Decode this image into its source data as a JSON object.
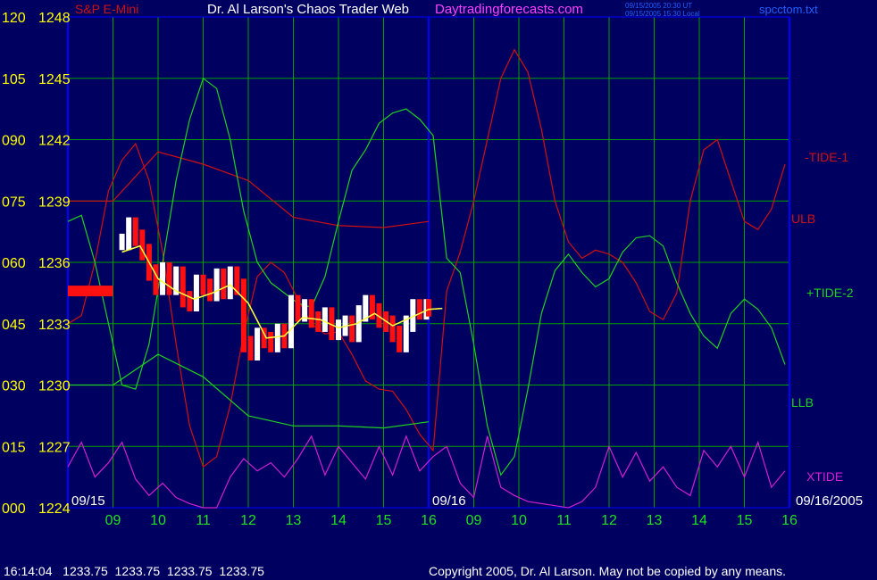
{
  "header": {
    "symbol": "S&P E-Mini",
    "title": "Dr. Al Larson's Chaos Trader Web",
    "site": "Daytradingforecasts.com",
    "time_utc": "09/15/2005 20:30 UT",
    "time_local": "09/15/2005 15:30 Local",
    "file": "spcctom.txt"
  },
  "footer": {
    "quote": "16:14:04   1233.75  1233.75  1233.75  1233.75",
    "copyright": "Copyright 2005, Dr. Al Larson. May not be copied by any means."
  },
  "colors": {
    "background": "#000060",
    "grid": "#00a000",
    "axis": "#0000ff",
    "tide1": "#d01010",
    "tide2": "#20d020",
    "xtide": "#d020d0",
    "price_up": "#ffffff",
    "price_down": "#ff1010",
    "avg": "#ffff40",
    "left_label": "#ffff00",
    "time_label": "#20e020",
    "title": "#ffffff",
    "site": "#ff40ff",
    "file": "#2060ff"
  },
  "chart_data": {
    "type": "line",
    "y_left_labels": [
      "000",
      "015",
      "030",
      "045",
      "060",
      "075",
      "090",
      "105",
      "120"
    ],
    "y_price_labels": [
      "1224",
      "1227",
      "1230",
      "1233",
      "1236",
      "1239",
      "1242",
      "1245",
      "1248"
    ],
    "ylim": [
      1224,
      1248
    ],
    "x_hours": [
      "09",
      "10",
      "11",
      "12",
      "13",
      "14",
      "15",
      "16",
      "09",
      "10",
      "11",
      "12",
      "13",
      "14",
      "15",
      "16"
    ],
    "date_left": "09/15",
    "date_mid": "09/16",
    "date_right": "09/16/2005",
    "right_labels": [
      "-TIDE-1",
      "ULB",
      "+TIDE-2",
      "LLB",
      "XTIDE"
    ],
    "series": [
      {
        "name": "-TIDE-1",
        "x": [
          0,
          0.3,
          0.6,
          0.9,
          1.2,
          1.5,
          1.8,
          2.1,
          2.4,
          2.7,
          3.0,
          3.3,
          3.6,
          3.9,
          4.2,
          4.5,
          4.8,
          5.1,
          5.4,
          5.7,
          6.0,
          6.3,
          6.6,
          6.9,
          7.2,
          7.5,
          7.8,
          8.1,
          8.4,
          8.7,
          9.0,
          9.3,
          9.6,
          9.9,
          10.2,
          10.5,
          10.8,
          11.1,
          11.4,
          11.7,
          12.0,
          12.3,
          12.6,
          12.9,
          13.2,
          13.5,
          13.8,
          14.1,
          14.4,
          14.7,
          15.0,
          15.3,
          15.6,
          15.9
        ],
        "y": [
          1233.0,
          1233.4,
          1236.0,
          1239.5,
          1241.0,
          1241.8,
          1240.0,
          1236.5,
          1232.0,
          1228.0,
          1226.0,
          1226.5,
          1229.0,
          1232.5,
          1235.3,
          1236.0,
          1235.5,
          1234.2,
          1233.0,
          1232.5,
          1232.6,
          1231.5,
          1230.2,
          1229.8,
          1229.7,
          1228.8,
          1227.6,
          1226.8,
          1234.6,
          1236.5,
          1239.0,
          1242.0,
          1245.0,
          1246.4,
          1245.3,
          1242.5,
          1239.0,
          1237.0,
          1236.2,
          1236.6,
          1236.4,
          1236.0,
          1235.0,
          1233.6,
          1233.2,
          1234.5,
          1239.0,
          1241.5,
          1242.0,
          1240.0,
          1238.0,
          1237.6,
          1238.6,
          1240.8
        ]
      },
      {
        "name": "ULB",
        "x": [
          0,
          1,
          2,
          3,
          4,
          5,
          6,
          7,
          8
        ],
        "y": [
          1239.0,
          1239.0,
          1241.4,
          1240.8,
          1240.0,
          1238.2,
          1237.8,
          1237.7,
          1238.0
        ]
      },
      {
        "name": "+TIDE-2",
        "x": [
          0,
          0.3,
          0.6,
          0.9,
          1.2,
          1.5,
          1.8,
          2.1,
          2.4,
          2.7,
          3.0,
          3.3,
          3.6,
          3.9,
          4.2,
          4.5,
          4.8,
          5.1,
          5.4,
          5.7,
          6.0,
          6.3,
          6.6,
          6.9,
          7.2,
          7.5,
          7.8,
          8.1,
          8.4,
          8.7,
          9.0,
          9.3,
          9.6,
          9.9,
          10.2,
          10.5,
          10.8,
          11.1,
          11.4,
          11.7,
          12.0,
          12.3,
          12.6,
          12.9,
          13.2,
          13.5,
          13.8,
          14.1,
          14.4,
          14.7,
          15.0,
          15.3,
          15.6,
          15.9
        ],
        "y": [
          1238.0,
          1238.3,
          1236.0,
          1233.0,
          1230.0,
          1229.8,
          1232.0,
          1236.0,
          1240.0,
          1243.0,
          1245.0,
          1244.5,
          1242.0,
          1238.5,
          1236.0,
          1235.0,
          1234.5,
          1234.0,
          1233.8,
          1235.3,
          1238.0,
          1240.5,
          1241.5,
          1242.8,
          1243.3,
          1243.5,
          1243.0,
          1242.2,
          1236.2,
          1235.5,
          1232.0,
          1228.0,
          1225.6,
          1226.5,
          1229.8,
          1233.5,
          1235.6,
          1236.4,
          1235.5,
          1234.8,
          1235.2,
          1236.5,
          1237.2,
          1237.3,
          1236.8,
          1235.0,
          1233.5,
          1232.4,
          1231.8,
          1233.5,
          1234.2,
          1233.7,
          1232.8,
          1231.0
        ]
      },
      {
        "name": "LLB",
        "x": [
          0,
          1,
          2,
          3,
          4,
          5,
          6,
          7,
          8
        ],
        "y": [
          1230.0,
          1230.0,
          1231.5,
          1230.4,
          1228.5,
          1228.0,
          1228.0,
          1227.9,
          1228.2
        ]
      },
      {
        "name": "XTIDE",
        "x": [
          0,
          0.3,
          0.6,
          0.9,
          1.2,
          1.5,
          1.8,
          2.1,
          2.4,
          2.7,
          3.0,
          3.3,
          3.6,
          3.9,
          4.2,
          4.5,
          4.8,
          5.1,
          5.4,
          5.7,
          6.0,
          6.3,
          6.6,
          6.9,
          7.2,
          7.5,
          7.8,
          8.1,
          8.4,
          8.7,
          9.0,
          9.3,
          9.6,
          9.9,
          10.2,
          10.5,
          10.8,
          11.1,
          11.4,
          11.7,
          12.0,
          12.3,
          12.6,
          12.9,
          13.2,
          13.5,
          13.8,
          14.1,
          14.4,
          14.7,
          15.0,
          15.3,
          15.6,
          15.9
        ],
        "y": [
          1226.0,
          1227.2,
          1225.5,
          1226.2,
          1227.2,
          1225.4,
          1224.6,
          1225.2,
          1224.5,
          1224.2,
          1224.0,
          1224.0,
          1225.5,
          1226.4,
          1225.8,
          1226.2,
          1225.5,
          1226.4,
          1227.5,
          1225.6,
          1227.0,
          1226.2,
          1225.4,
          1227.0,
          1225.6,
          1227.5,
          1225.8,
          1226.5,
          1227.0,
          1225.2,
          1224.5,
          1227.5,
          1225.0,
          1224.6,
          1224.3,
          1224.2,
          1224.1,
          1224.0,
          1224.3,
          1225.0,
          1227.0,
          1225.5,
          1226.7,
          1225.3,
          1226.0,
          1225.0,
          1224.6,
          1226.8,
          1226.0,
          1227.0,
          1225.5,
          1227.2,
          1225.0,
          1225.8
        ]
      },
      {
        "name": "price",
        "x": [
          1.2,
          1.35,
          1.5,
          1.65,
          1.8,
          1.95,
          2.1,
          2.25,
          2.4,
          2.55,
          2.7,
          2.85,
          3.0,
          3.15,
          3.3,
          3.45,
          3.6,
          3.75,
          3.9,
          4.05,
          4.2,
          4.35,
          4.5,
          4.65,
          4.8,
          4.95,
          5.1,
          5.25,
          5.4,
          5.55,
          5.7,
          5.85,
          6.0,
          6.15,
          6.3,
          6.45,
          6.6,
          6.75,
          6.9,
          7.05,
          7.2,
          7.35,
          7.5,
          7.65,
          7.8,
          7.95,
          8.0
        ],
        "y": [
          1237.0,
          1237.8,
          1237.2,
          1236.5,
          1235.5,
          1234.8,
          1235.6,
          1234.8,
          1235.4,
          1234.2,
          1234.0,
          1235.0,
          1234.8,
          1234.5,
          1235.3,
          1234.6,
          1235.4,
          1234.8,
          1232.0,
          1231.6,
          1232.4,
          1232.2,
          1232.0,
          1232.6,
          1232.2,
          1234.0,
          1233.5,
          1233.8,
          1233.2,
          1233.0,
          1233.4,
          1232.6,
          1232.8,
          1233.0,
          1232.5,
          1233.5,
          1234.0,
          1233.6,
          1233.2,
          1233.0,
          1232.5,
          1232.0,
          1233.0,
          1233.8,
          1233.6,
          1233.8,
          1233.75
        ]
      },
      {
        "name": "avg",
        "x": [
          1.2,
          1.6,
          2.0,
          2.4,
          2.8,
          3.2,
          3.6,
          4.0,
          4.4,
          4.8,
          5.2,
          5.6,
          6.0,
          6.4,
          6.8,
          7.2,
          7.6,
          8.0,
          8.3
        ],
        "y": [
          1236.5,
          1236.8,
          1235.2,
          1234.6,
          1234.2,
          1234.5,
          1234.9,
          1234.0,
          1232.3,
          1232.4,
          1233.3,
          1233.2,
          1232.8,
          1233.0,
          1233.5,
          1232.9,
          1233.3,
          1233.7,
          1233.75
        ]
      },
      {
        "name": "start-bar",
        "x": [
          0,
          1
        ],
        "y": [
          1234.6,
          1234.6
        ]
      }
    ]
  }
}
